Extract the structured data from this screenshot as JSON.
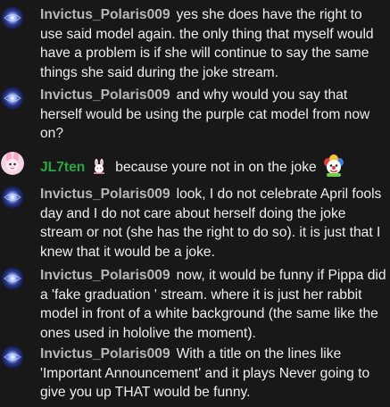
{
  "messages": [
    {
      "author": "Invictus_Polaris009",
      "text": "yes she does have the right to use said model again. the only thing that myself would have a problem is if she will continue to say the same things she said during the joke stream."
    },
    {
      "author": "Invictus_Polaris009",
      "text": "and why would you say that herself would be using the purple cat model from now on?"
    },
    {
      "author": "JL7ten",
      "text": "because youre not in on the joke",
      "badge_icon": "bunny-badge-icon",
      "emoji_icon": "clown-emoji-icon"
    },
    {
      "author": "Invictus_Polaris009",
      "text": "look, I do not celebrate April fools day and I do not care about herself doing the joke stream or not (she has the right to do so). it is just that I knew that it would be a joke."
    },
    {
      "author": "Invictus_Polaris009",
      "text": "now, it would be funny if Pippa did a 'fake graduation ' stream. where it is just her rabbit model in front of a white background (the same like the ones used in hololive the moment)."
    },
    {
      "author": "Invictus_Polaris009",
      "text": "With a title on the lines like 'Important Announcement' and it plays Never going to give you up THAT would be funny."
    }
  ],
  "colors": {
    "background": "#181818",
    "author_default": "#b7b7b7",
    "author_member": "#2ba640",
    "message_text": "#eeeeee"
  }
}
